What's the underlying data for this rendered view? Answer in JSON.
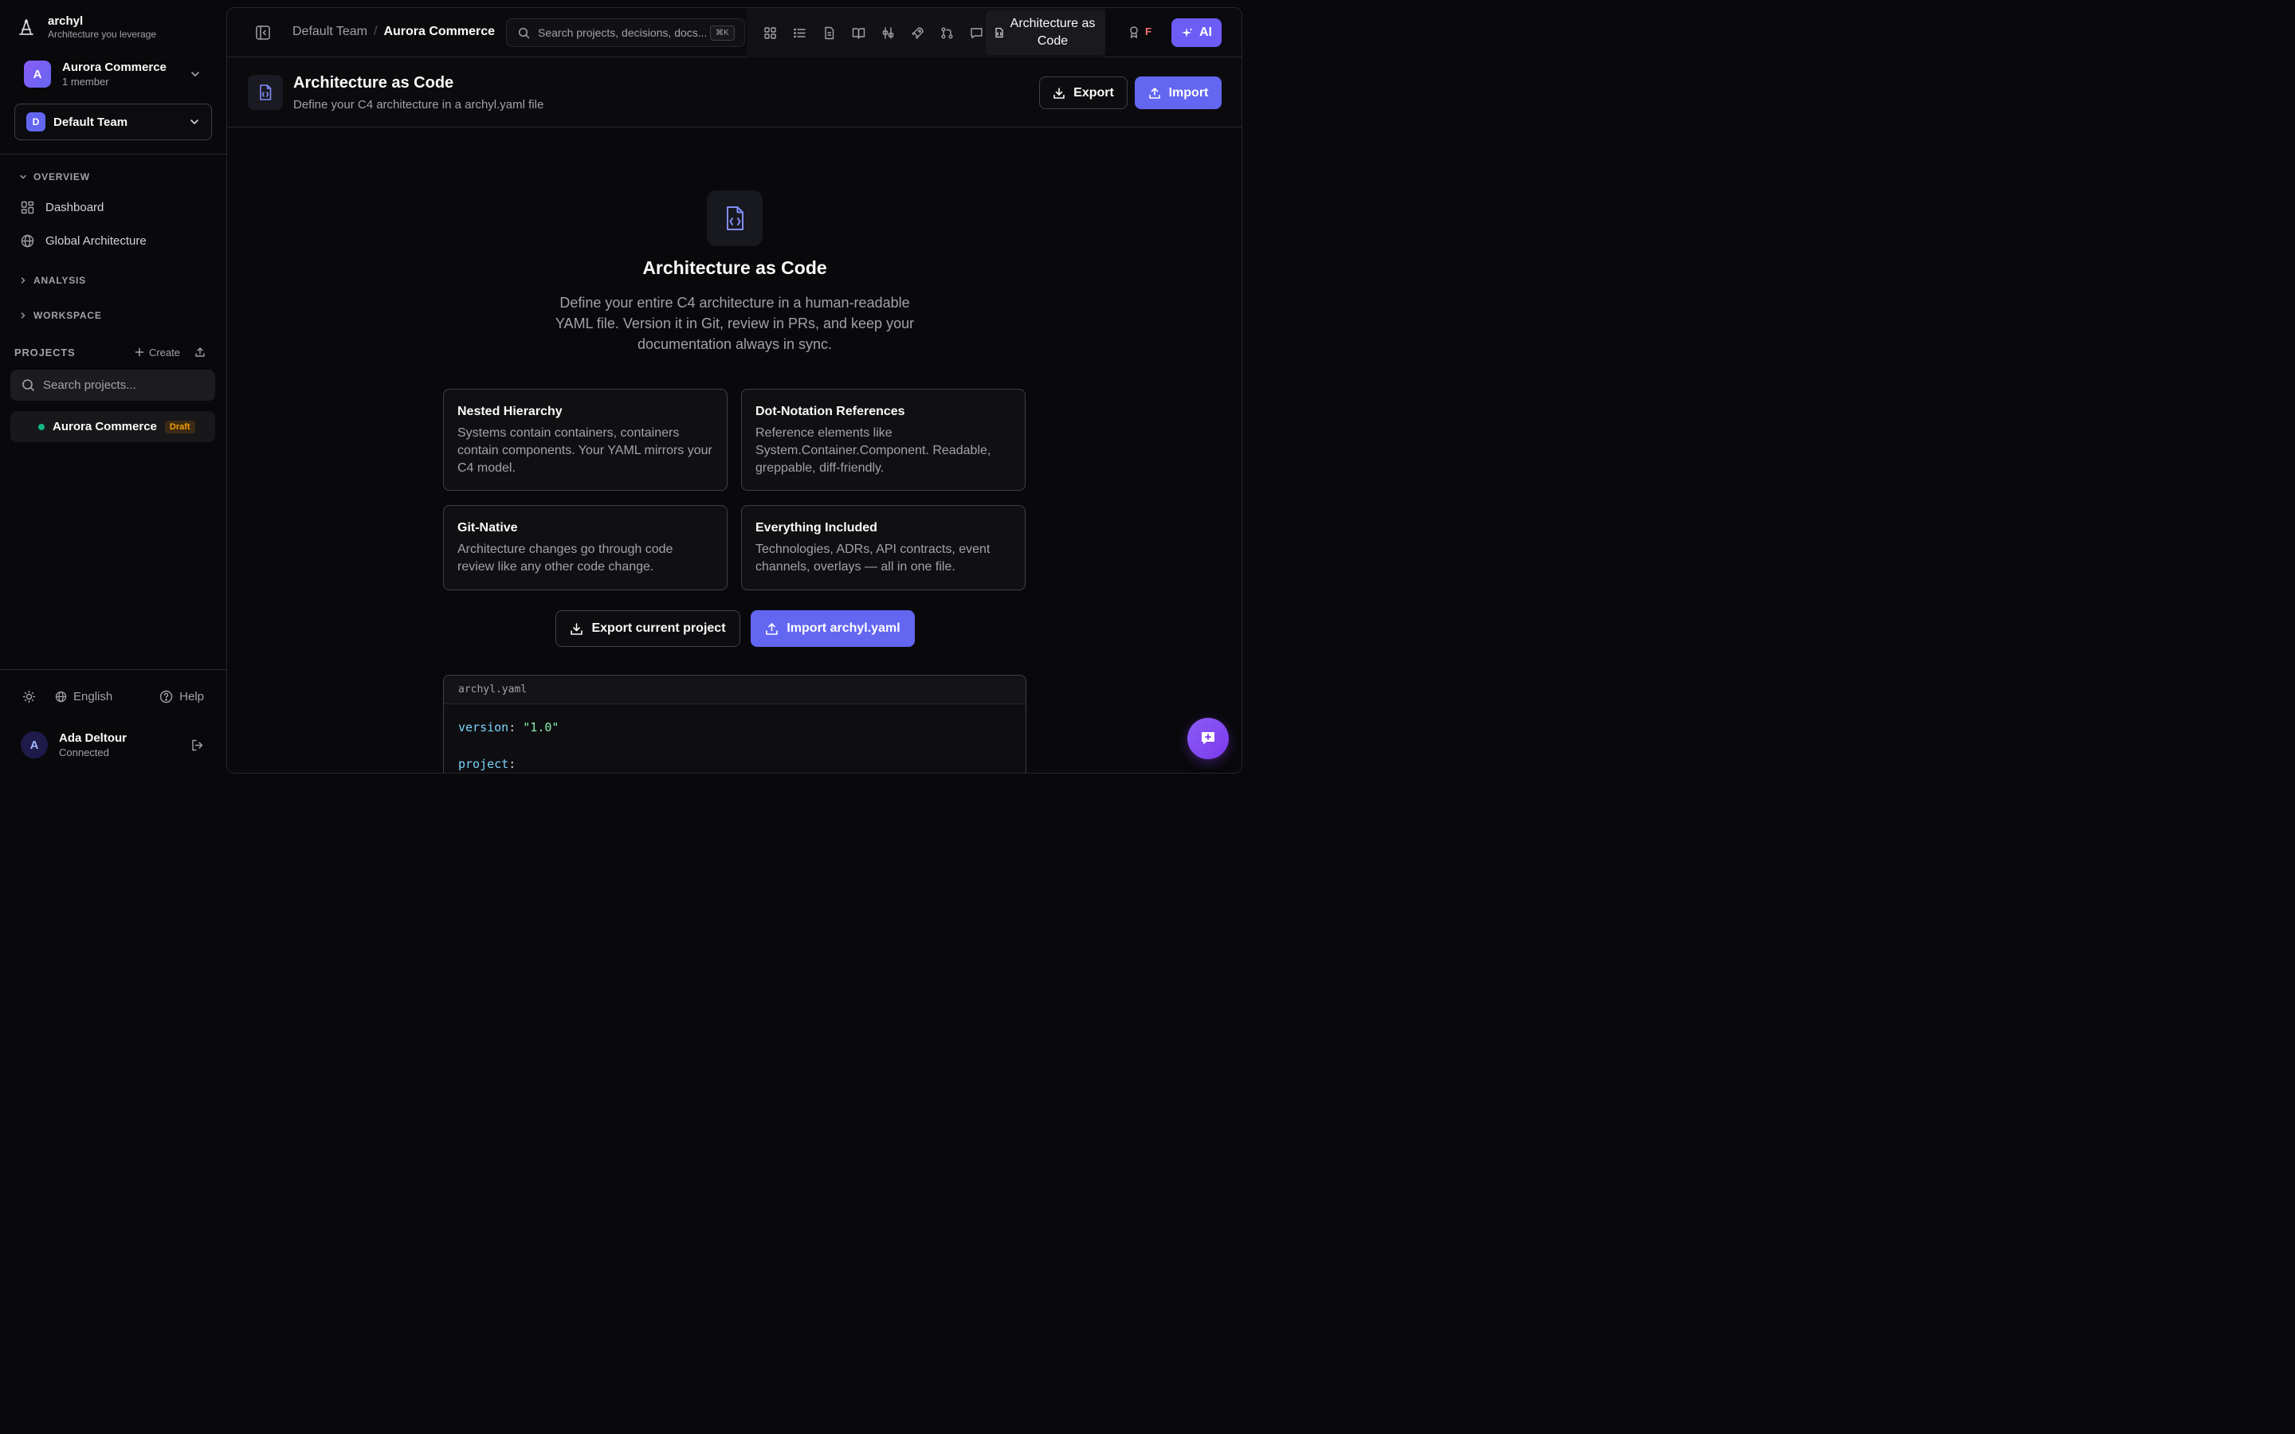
{
  "brand": {
    "name": "archyl",
    "tagline": "Architecture you leverage"
  },
  "project_switcher": {
    "initial": "A",
    "name": "Aurora Commerce",
    "members": "1 member"
  },
  "team_select": {
    "initial": "D",
    "name": "Default Team"
  },
  "sections": {
    "overview": "OVERVIEW",
    "analysis": "ANALYSIS",
    "workspace": "WORKSPACE"
  },
  "nav": {
    "dashboard": "Dashboard",
    "global_architecture": "Global Architecture"
  },
  "projects": {
    "header": "PROJECTS",
    "create_label": "Create",
    "search_placeholder": "Search projects...",
    "items": [
      {
        "name": "Aurora Commerce",
        "badge": "Draft"
      }
    ]
  },
  "footer": {
    "language": "English",
    "help": "Help"
  },
  "user": {
    "initial": "A",
    "name": "Ada Deltour",
    "status": "Connected"
  },
  "topbar": {
    "breadcrumb": [
      "Default Team",
      "Aurora Commerce"
    ],
    "breadcrumb_sep": "/",
    "search_placeholder": "Search projects, decisions, docs...",
    "search_shortcut": "⌘K",
    "active_tab": "Architecture as Code",
    "badge_letter": "F",
    "ai_label": "AI"
  },
  "page_header": {
    "title": "Architecture as Code",
    "subtitle": "Define your C4 architecture in a archyl.yaml file",
    "export_label": "Export",
    "import_label": "Import"
  },
  "hero": {
    "title": "Architecture as Code",
    "description": "Define your entire C4 architecture in a human-readable YAML file. Version it in Git, review in PRs, and keep your documentation always in sync."
  },
  "features": [
    {
      "title": "Nested Hierarchy",
      "text": "Systems contain containers, containers contain components. Your YAML mirrors your C4 model."
    },
    {
      "title": "Dot-Notation References",
      "text": "Reference elements like System.Container.Component. Readable, greppable, diff-friendly."
    },
    {
      "title": "Git-Native",
      "text": "Architecture changes go through code review like any other code change."
    },
    {
      "title": "Everything Included",
      "text": "Technologies, ADRs, API contracts, event channels, overlays — all in one file."
    }
  ],
  "actions": {
    "export_label": "Export current project",
    "import_label": "Import archyl.yaml"
  },
  "code": {
    "filename": "archyl.yaml",
    "line1_key": "version",
    "line1_value": "\"1.0\"",
    "line2_key": "project"
  },
  "colors": {
    "accent": "#6366f1",
    "ai": "#6d5cf6",
    "success": "#10b981",
    "draft": "#f59e0b",
    "alert": "#f87171"
  }
}
